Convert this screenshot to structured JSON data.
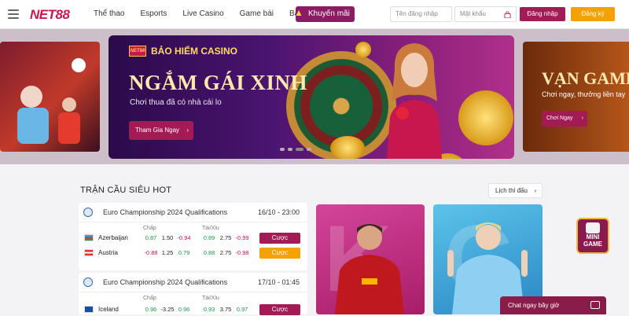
{
  "header": {
    "logo": "NET88",
    "nav": [
      "Thể thao",
      "Esports",
      "Live Casino",
      "Game bài",
      "Bắn cá"
    ],
    "promo": "Khuyến mãi",
    "username_placeholder": "Tên đăng nhập",
    "password_placeholder": "Mật khẩu",
    "login": "Đăng nhập",
    "register": "Đăng ký"
  },
  "banner": {
    "badge_logo": "NET88",
    "badge": "BẢO HIỂM CASINO",
    "headline": "NGẮM GÁI XINH",
    "sub": "Chơi thua đã có nhà cái lo",
    "cta": "Tham Gia Ngay",
    "right_headline": "VẠN GAME",
    "right_sub": "Chơi ngay, thưởng liền tay",
    "right_cta": "Chơi Ngay"
  },
  "section": {
    "title": "TRẬN CẦU SIÊU HOT",
    "schedule": "Lịch thi đấu"
  },
  "matches": [
    {
      "name": "Euro Championship 2024 Qualifications",
      "date": "16/10 - 23:00",
      "col1": "Chấp",
      "col2": "Tài/Xỉu",
      "teams": [
        {
          "name": "Azerbaijan",
          "h1": "0.87",
          "h2": "1.50",
          "h3": "-0.94",
          "o1": "0.89",
          "o2": "2.75",
          "o3": "-0.99",
          "bet": "Cược"
        },
        {
          "name": "Austria",
          "h1": "-0.88",
          "h2": "1.25",
          "h3": "0.79",
          "o1": "0.88",
          "o2": "2.75",
          "o3": "-0.98",
          "bet": "Cược"
        }
      ]
    },
    {
      "name": "Euro Championship 2024 Qualifications",
      "date": "17/10 - 01:45",
      "col1": "Chấp",
      "col2": "Tài/Xỉu",
      "teams": [
        {
          "name": "Iceland",
          "h1": "0.96",
          "h2": "-3.25",
          "h3": "0.96",
          "o1": "0.93",
          "o2": "3.75",
          "o3": "0.97",
          "bet": "Cược"
        }
      ]
    }
  ],
  "minigame": [
    "MINI",
    "GAME"
  ],
  "chat": "Chat ngay bây giờ",
  "colors": {
    "brand": "#c8174e",
    "primary_button": "#a31b55",
    "secondary_button": "#f5a200"
  }
}
